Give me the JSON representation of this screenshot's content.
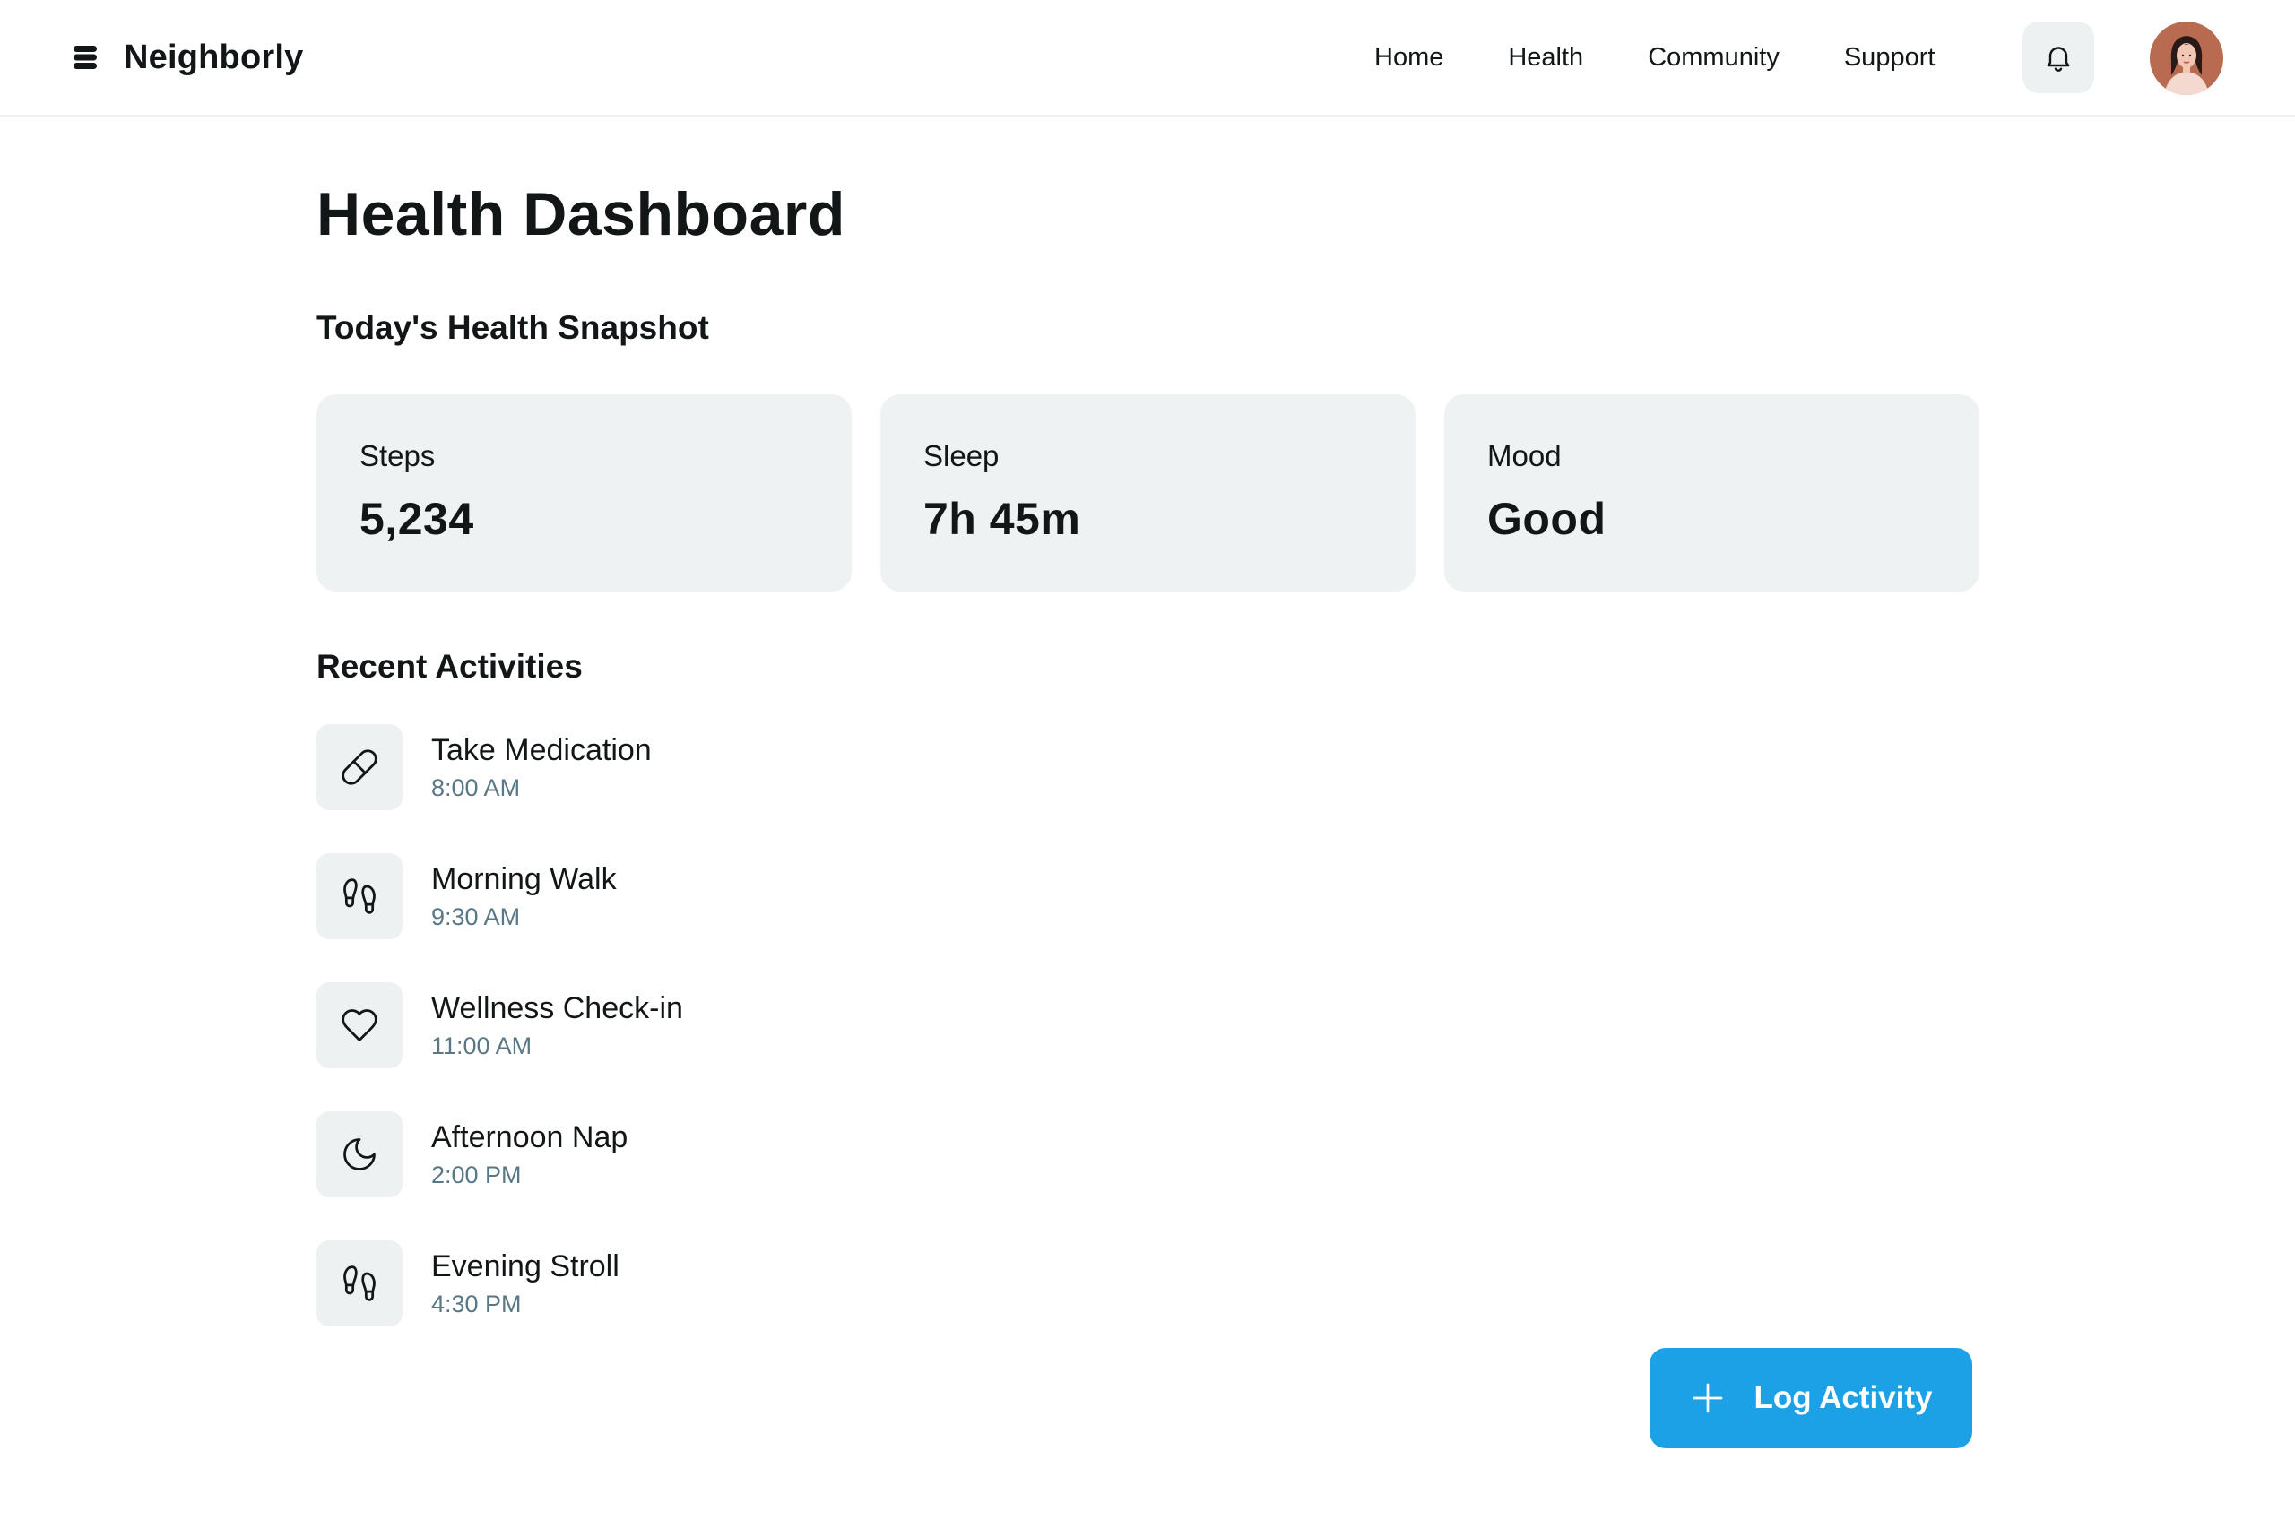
{
  "app": {
    "name": "Neighborly"
  },
  "nav": {
    "items": [
      {
        "label": "Home"
      },
      {
        "label": "Health"
      },
      {
        "label": "Community"
      },
      {
        "label": "Support"
      }
    ]
  },
  "page": {
    "title": "Health Dashboard"
  },
  "snapshot": {
    "title": "Today's Health Snapshot",
    "cards": [
      {
        "label": "Steps",
        "value": "5,234"
      },
      {
        "label": "Sleep",
        "value": "7h 45m"
      },
      {
        "label": "Mood",
        "value": "Good"
      }
    ]
  },
  "recent": {
    "title": "Recent Activities",
    "items": [
      {
        "name": "Take Medication",
        "time": "8:00 AM",
        "icon": "pill-icon"
      },
      {
        "name": "Morning Walk",
        "time": "9:30 AM",
        "icon": "footprints-icon"
      },
      {
        "name": "Wellness Check-in",
        "time": "11:00 AM",
        "icon": "heart-icon"
      },
      {
        "name": "Afternoon Nap",
        "time": "2:00 PM",
        "icon": "moon-icon"
      },
      {
        "name": "Evening Stroll",
        "time": "4:30 PM",
        "icon": "footprints-icon"
      }
    ]
  },
  "actions": {
    "log_activity": "Log Activity"
  },
  "colors": {
    "accent": "#1da1e6",
    "card_bg": "#eff2f3",
    "muted_text": "#5a7785"
  }
}
